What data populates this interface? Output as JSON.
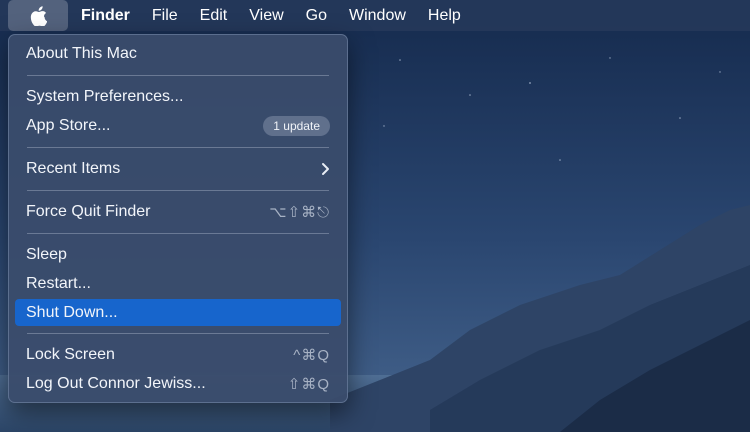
{
  "menubar": {
    "items": [
      {
        "label": "Finder",
        "bold": true
      },
      {
        "label": "File"
      },
      {
        "label": "Edit"
      },
      {
        "label": "View"
      },
      {
        "label": "Go"
      },
      {
        "label": "Window"
      },
      {
        "label": "Help"
      }
    ]
  },
  "apple_menu": {
    "about": "About This Mac",
    "system_preferences": "System Preferences...",
    "app_store": "App Store...",
    "app_store_badge": "1 update",
    "recent_items": "Recent Items",
    "force_quit": "Force Quit Finder",
    "force_quit_shortcut": "⌥⇧⌘⎋",
    "sleep": "Sleep",
    "restart": "Restart...",
    "shut_down": "Shut Down...",
    "lock_screen": "Lock Screen",
    "lock_screen_shortcut": "^⌘Q",
    "log_out": "Log Out Connor Jewiss...",
    "log_out_shortcut": "⇧⌘Q"
  },
  "colors": {
    "menubar": "#24385a",
    "menu_background": "#3a4c6c",
    "highlight": "#1765cc"
  }
}
